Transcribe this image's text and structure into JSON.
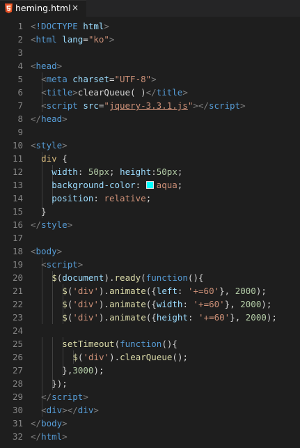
{
  "tab": {
    "filename": "heming.html",
    "close_glyph": "×",
    "icon": "html-file-icon"
  },
  "editor": {
    "lines": [
      {
        "n": "1",
        "indent": 2,
        "tokens": [
          [
            "punc",
            "<"
          ],
          [
            "tag",
            "!DOCTYPE"
          ],
          [
            "text",
            " "
          ],
          [
            "attr",
            "html"
          ],
          [
            "punc",
            ">"
          ]
        ]
      },
      {
        "n": "2",
        "indent": 2,
        "tokens": [
          [
            "punc",
            "<"
          ],
          [
            "tag",
            "html"
          ],
          [
            "text",
            " "
          ],
          [
            "attr",
            "lang"
          ],
          [
            "text",
            "="
          ],
          [
            "str",
            "\"ko\""
          ],
          [
            "punc",
            ">"
          ]
        ]
      },
      {
        "n": "3",
        "indent": 0,
        "tokens": []
      },
      {
        "n": "4",
        "indent": 2,
        "tokens": [
          [
            "punc",
            "<"
          ],
          [
            "tag",
            "head"
          ],
          [
            "punc",
            ">"
          ]
        ]
      },
      {
        "n": "5",
        "indent": 4,
        "tokens": [
          [
            "punc",
            "<"
          ],
          [
            "tag",
            "meta"
          ],
          [
            "text",
            " "
          ],
          [
            "attr",
            "charset"
          ],
          [
            "text",
            "="
          ],
          [
            "str",
            "\"UTF-8\""
          ],
          [
            "punc",
            ">"
          ]
        ]
      },
      {
        "n": "6",
        "indent": 4,
        "tokens": [
          [
            "punc",
            "<"
          ],
          [
            "tag",
            "title"
          ],
          [
            "punc",
            ">"
          ],
          [
            "text",
            "clearQueue( )"
          ],
          [
            "punc",
            "</"
          ],
          [
            "tag",
            "title"
          ],
          [
            "punc",
            ">"
          ]
        ]
      },
      {
        "n": "7",
        "indent": 4,
        "tokens": [
          [
            "punc",
            "<"
          ],
          [
            "tag",
            "script"
          ],
          [
            "text",
            " "
          ],
          [
            "attr",
            "src"
          ],
          [
            "text",
            "="
          ],
          [
            "str",
            "\""
          ],
          [
            "link",
            "jquery-3.3.1.js"
          ],
          [
            "str",
            "\""
          ],
          [
            "punc",
            "></"
          ],
          [
            "tag",
            "script"
          ],
          [
            "punc",
            ">"
          ]
        ]
      },
      {
        "n": "8",
        "indent": 2,
        "tokens": [
          [
            "punc",
            "</"
          ],
          [
            "tag",
            "head"
          ],
          [
            "punc",
            ">"
          ]
        ]
      },
      {
        "n": "9",
        "indent": 0,
        "tokens": []
      },
      {
        "n": "10",
        "indent": 2,
        "tokens": [
          [
            "punc",
            "<"
          ],
          [
            "tag",
            "style"
          ],
          [
            "punc",
            ">"
          ]
        ]
      },
      {
        "n": "11",
        "indent": 4,
        "tokens": [
          [
            "sel",
            "div"
          ],
          [
            "text",
            " {"
          ]
        ]
      },
      {
        "n": "12",
        "indent": 6,
        "tokens": [
          [
            "prop",
            "width"
          ],
          [
            "text",
            ": "
          ],
          [
            "num",
            "50px"
          ],
          [
            "text",
            "; "
          ],
          [
            "prop",
            "height"
          ],
          [
            "text",
            ":"
          ],
          [
            "num",
            "50px"
          ],
          [
            "text",
            ";"
          ]
        ]
      },
      {
        "n": "13",
        "indent": 6,
        "tokens": [
          [
            "prop",
            "background-color"
          ],
          [
            "text",
            ": "
          ],
          [
            "swatch",
            "#00ffff"
          ],
          [
            "str",
            "aqua"
          ],
          [
            "text",
            ";"
          ]
        ]
      },
      {
        "n": "14",
        "indent": 6,
        "tokens": [
          [
            "prop",
            "position"
          ],
          [
            "text",
            ": "
          ],
          [
            "str",
            "relative"
          ],
          [
            "text",
            ";"
          ]
        ]
      },
      {
        "n": "15",
        "indent": 4,
        "tokens": [
          [
            "text",
            "}"
          ]
        ]
      },
      {
        "n": "16",
        "indent": 2,
        "tokens": [
          [
            "punc",
            "</"
          ],
          [
            "tag",
            "style"
          ],
          [
            "punc",
            ">"
          ]
        ]
      },
      {
        "n": "17",
        "indent": 0,
        "tokens": []
      },
      {
        "n": "18",
        "indent": 2,
        "tokens": [
          [
            "punc",
            "<"
          ],
          [
            "tag",
            "body"
          ],
          [
            "punc",
            ">"
          ]
        ]
      },
      {
        "n": "19",
        "indent": 4,
        "tokens": [
          [
            "punc",
            "<"
          ],
          [
            "tag",
            "script"
          ],
          [
            "punc",
            ">"
          ]
        ]
      },
      {
        "n": "20",
        "indent": 6,
        "tokens": [
          [
            "fn",
            "$"
          ],
          [
            "text",
            "("
          ],
          [
            "attr",
            "document"
          ],
          [
            "text",
            ")."
          ],
          [
            "fn",
            "ready"
          ],
          [
            "text",
            "("
          ],
          [
            "kw",
            "function"
          ],
          [
            "text",
            "(){"
          ]
        ]
      },
      {
        "n": "21",
        "indent": 8,
        "tokens": [
          [
            "fn",
            "$"
          ],
          [
            "text",
            "("
          ],
          [
            "str",
            "'div'"
          ],
          [
            "text",
            ")."
          ],
          [
            "fn",
            "animate"
          ],
          [
            "text",
            "({"
          ],
          [
            "attr",
            "left"
          ],
          [
            "text",
            ": "
          ],
          [
            "str",
            "'+=60'"
          ],
          [
            "text",
            "}, "
          ],
          [
            "num",
            "2000"
          ],
          [
            "text",
            ");"
          ]
        ]
      },
      {
        "n": "22",
        "indent": 8,
        "tokens": [
          [
            "fn",
            "$"
          ],
          [
            "text",
            "("
          ],
          [
            "str",
            "'div'"
          ],
          [
            "text",
            ")."
          ],
          [
            "fn",
            "animate"
          ],
          [
            "text",
            "({"
          ],
          [
            "attr",
            "width"
          ],
          [
            "text",
            ": "
          ],
          [
            "str",
            "'+=60'"
          ],
          [
            "text",
            "}, "
          ],
          [
            "num",
            "2000"
          ],
          [
            "text",
            ");"
          ]
        ]
      },
      {
        "n": "23",
        "indent": 8,
        "tokens": [
          [
            "fn",
            "$"
          ],
          [
            "text",
            "("
          ],
          [
            "str",
            "'div'"
          ],
          [
            "text",
            ")."
          ],
          [
            "fn",
            "animate"
          ],
          [
            "text",
            "({"
          ],
          [
            "attr",
            "height"
          ],
          [
            "text",
            ": "
          ],
          [
            "str",
            "'+=60'"
          ],
          [
            "text",
            "}, "
          ],
          [
            "num",
            "2000"
          ],
          [
            "text",
            ");"
          ]
        ]
      },
      {
        "n": "24",
        "indent": 0,
        "tokens": []
      },
      {
        "n": "25",
        "indent": 8,
        "tokens": [
          [
            "fn",
            "setTimeout"
          ],
          [
            "text",
            "("
          ],
          [
            "kw",
            "function"
          ],
          [
            "text",
            "(){"
          ]
        ]
      },
      {
        "n": "26",
        "indent": 10,
        "tokens": [
          [
            "fn",
            "$"
          ],
          [
            "text",
            "("
          ],
          [
            "str",
            "'div'"
          ],
          [
            "text",
            ")."
          ],
          [
            "fn",
            "clearQueue"
          ],
          [
            "text",
            "();"
          ]
        ]
      },
      {
        "n": "27",
        "indent": 8,
        "tokens": [
          [
            "text",
            "},"
          ],
          [
            "num",
            "3000"
          ],
          [
            "text",
            ");"
          ]
        ]
      },
      {
        "n": "28",
        "indent": 6,
        "tokens": [
          [
            "text",
            "});"
          ]
        ]
      },
      {
        "n": "29",
        "indent": 4,
        "tokens": [
          [
            "punc",
            "</"
          ],
          [
            "tag",
            "script"
          ],
          [
            "punc",
            ">"
          ]
        ]
      },
      {
        "n": "30",
        "indent": 4,
        "tokens": [
          [
            "punc",
            "<"
          ],
          [
            "tag",
            "div"
          ],
          [
            "punc",
            "></"
          ],
          [
            "tag",
            "div"
          ],
          [
            "punc",
            ">"
          ]
        ]
      },
      {
        "n": "31",
        "indent": 2,
        "tokens": [
          [
            "punc",
            "</"
          ],
          [
            "tag",
            "body"
          ],
          [
            "punc",
            ">"
          ]
        ]
      },
      {
        "n": "32",
        "indent": 2,
        "tokens": [
          [
            "punc",
            "</"
          ],
          [
            "tag",
            "html"
          ],
          [
            "punc",
            ">"
          ]
        ]
      }
    ]
  },
  "colors": {
    "background": "#1e1e1e",
    "tab_bar": "#252526",
    "line_number": "#858585",
    "tag": "#569cd6",
    "attribute": "#9cdcfe",
    "string": "#ce9178",
    "function": "#dcdcaa",
    "number": "#b5cea8",
    "selector": "#d7ba7d",
    "punctuation": "#808080",
    "swatch_aqua": "#00ffff"
  }
}
